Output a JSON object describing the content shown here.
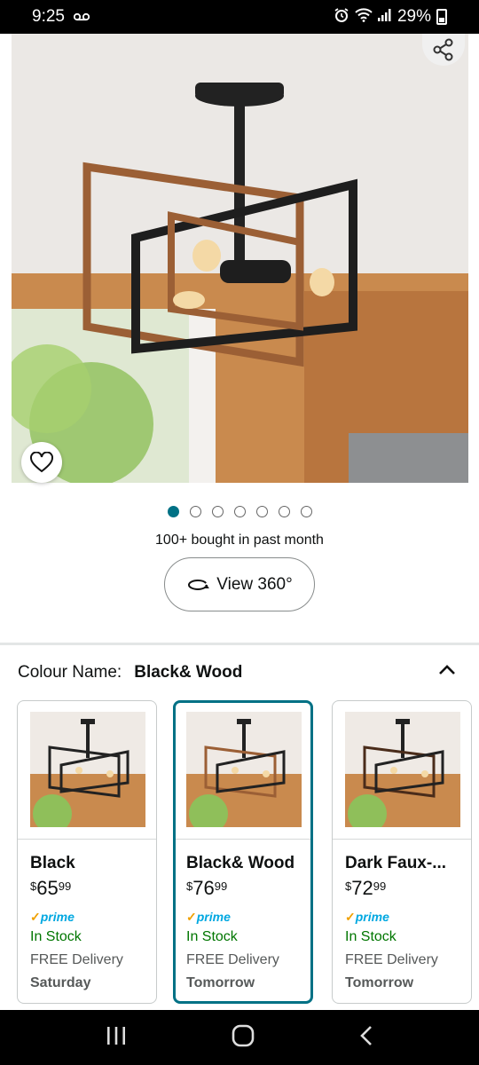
{
  "status_bar": {
    "time": "9:25",
    "voicemail_icon": "voicemail-icon",
    "battery": "29%"
  },
  "product": {
    "image_dots_count": 7,
    "active_dot": 0,
    "bought_text": "100+ bought in past month",
    "view360_label": "View 360°"
  },
  "colour": {
    "label": "Colour Name:",
    "value": "Black& Wood"
  },
  "variants": [
    {
      "name": "Black",
      "currency": "$",
      "price_whole": "65",
      "price_cents": "99",
      "prime": "prime",
      "stock": "In Stock",
      "delivery": "FREE Delivery",
      "day": "Saturday",
      "selected": false
    },
    {
      "name": "Black& Wood",
      "currency": "$",
      "price_whole": "76",
      "price_cents": "99",
      "prime": "prime",
      "stock": "In Stock",
      "delivery": "FREE Delivery",
      "day": "Tomorrow",
      "selected": true
    },
    {
      "name": "Dark Faux-...",
      "currency": "$",
      "price_whole": "72",
      "price_cents": "99",
      "prime": "prime",
      "stock": "In Stock",
      "delivery": "FREE Delivery",
      "day": "Tomorrow",
      "selected": false
    }
  ],
  "colors": {
    "accent": "#007185",
    "in_stock": "#007600",
    "prime": "#00a8e1"
  }
}
